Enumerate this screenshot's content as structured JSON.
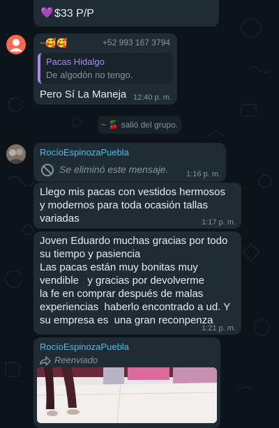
{
  "msg_top": {
    "emoji": "💜",
    "text": "$33 P/P"
  },
  "msg_quote": {
    "sender_emoji": "~🥰🥰",
    "phone": "+52 993 167 3794",
    "quote_sender": "Pacas Hidalgo",
    "quote_text": "De algodón no tengo.",
    "text": "Pero Sí La Maneja",
    "time": "12:40 p. m."
  },
  "system_msg": {
    "text": "~ 🍒 salió del grupo."
  },
  "msg_deleted": {
    "sender": "RocíoEspinozaPuebla",
    "text": "Se eliminó este mensaje.",
    "time": "1:16 p. m."
  },
  "msg_2": {
    "lines": [
      "Llego mis pacas con vestidos hermosos",
      "y modernos para toda ocasión tallas",
      "variadas"
    ],
    "time": "1:17 p. m."
  },
  "msg_3": {
    "lines": [
      "Joven Eduardo muchas gracias por todo",
      "su tiempo y pasiencia",
      "Las pacas están muy bonitas muy",
      "vendible   y gracias por devolverme",
      "la fe en comprar después de malas",
      "experiencias  haberlo encontrado a ud. Y",
      "su empresa es  una gran reconpenza"
    ],
    "time": "1:21 p. m."
  },
  "msg_forward": {
    "sender": "RocíoEspinozaPuebla",
    "forward_label": "Reenviado"
  },
  "colors": {
    "background": "#0c1319",
    "bubble": "#202c33",
    "sender_blue": "#53bdeb",
    "quote_bar": "#a68cf0",
    "meta": "#8696a0"
  }
}
